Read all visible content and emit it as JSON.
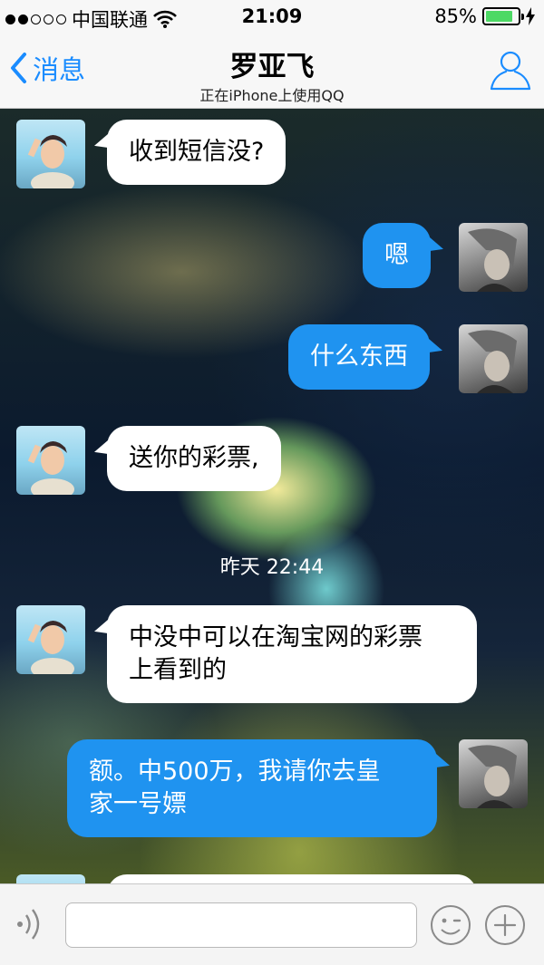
{
  "status_bar": {
    "carrier": "中国联通",
    "time": "21:09",
    "battery": "85%",
    "battery_level": 0.85,
    "signal_bars_filled": 2,
    "signal_bars_total": 5
  },
  "nav": {
    "back_label": "消息",
    "title": "罗亚飞",
    "subtitle": "正在iPhone上使用QQ",
    "accent_color": "#1a8cff"
  },
  "messages": [
    {
      "from": "friend",
      "text": "收到短信没?"
    },
    {
      "from": "self",
      "text": "嗯"
    },
    {
      "from": "self",
      "text": "什么东西"
    },
    {
      "from": "friend",
      "text": "送你的彩票,"
    },
    {
      "from": "friend",
      "line1": "中没中可以在淘宝网的彩票",
      "line2": "上看到的"
    },
    {
      "from": "self",
      "line1": "额。中500万，我请你去皇",
      "line2": "家一号嫖"
    }
  ],
  "timestamp": "昨天 22:44",
  "colors": {
    "outgoing_bubble": "#1f93f0",
    "incoming_bubble": "#ffffff",
    "battery_fill": "#4cd964"
  },
  "input": {
    "value": "",
    "placeholder": ""
  },
  "icons": [
    "chevron-left-icon",
    "profile-icon",
    "voice-icon",
    "emoji-icon",
    "plus-icon",
    "wifi-icon",
    "battery-icon",
    "charging-icon"
  ]
}
